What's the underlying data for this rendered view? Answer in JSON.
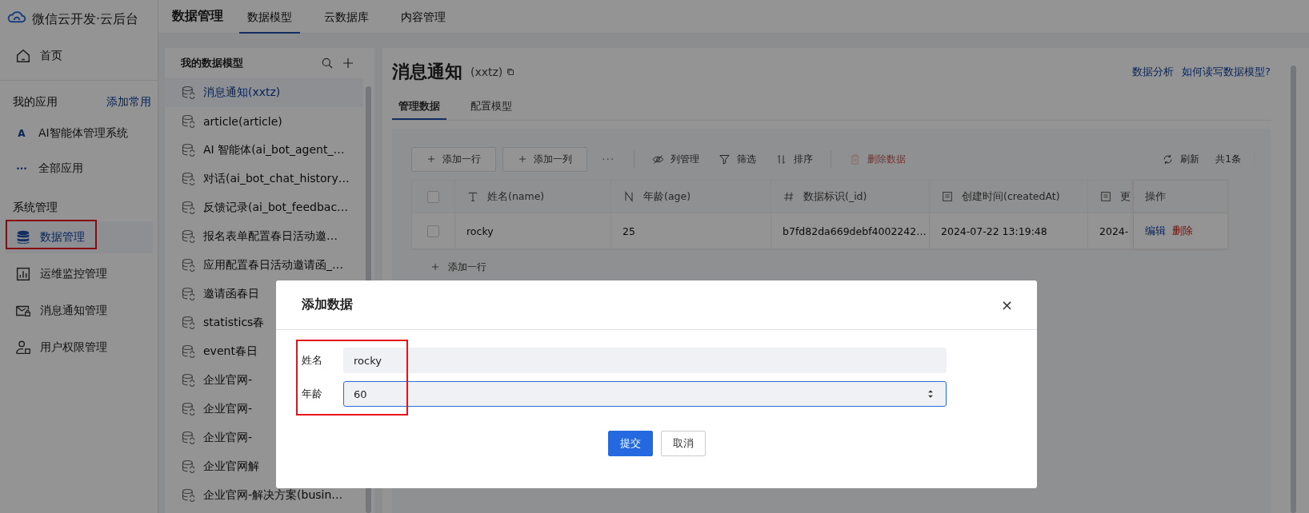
{
  "sidebar": {
    "logo": "微信云开发·云后台",
    "home": {
      "label": "首页",
      "selected": false
    },
    "apps_section": {
      "title": "我的应用",
      "action": "添加常用"
    },
    "apps": [
      {
        "avatar": "A",
        "label": "AI智能体管理系统"
      },
      {
        "avatar": "···",
        "label": "全部应用"
      }
    ],
    "system_section": {
      "title": "系统管理"
    },
    "items": [
      {
        "label": "数据管理",
        "selected": true,
        "marked": true
      },
      {
        "label": "运维监控管理",
        "selected": false,
        "marked": false
      },
      {
        "label": "消息通知管理",
        "selected": false,
        "marked": false
      },
      {
        "label": "用户权限管理",
        "selected": false,
        "marked": false
      }
    ]
  },
  "top_nav": {
    "title": "数据管理",
    "tabs": [
      {
        "label": "数据模型",
        "selected": true
      },
      {
        "label": "云数据库",
        "selected": false
      },
      {
        "label": "内容管理",
        "selected": false
      }
    ]
  },
  "model_list": {
    "title": "我的数据模型",
    "items": [
      {
        "label": "消息通知(xxtz)",
        "selected": true
      },
      {
        "label": "article(article)",
        "selected": false
      },
      {
        "label": "AI 智能体(ai_bot_agent_…",
        "selected": false
      },
      {
        "label": "对话(ai_bot_chat_history…",
        "selected": false
      },
      {
        "label": "反馈记录(ai_bot_feedbac…",
        "selected": false
      },
      {
        "label": "报名表单配置春日活动邀…",
        "selected": false
      },
      {
        "label": "应用配置春日活动邀请函_…",
        "selected": false
      },
      {
        "label": "邀请函春日",
        "selected": false
      },
      {
        "label": "statistics春",
        "selected": false
      },
      {
        "label": "event春日",
        "selected": false
      },
      {
        "label": "企业官网-",
        "selected": false
      },
      {
        "label": "企业官网-",
        "selected": false
      },
      {
        "label": "企业官网-",
        "selected": false
      },
      {
        "label": "企业官网解",
        "selected": false
      },
      {
        "label": "企业官网-解决方案(busin…",
        "selected": false
      }
    ]
  },
  "model": {
    "title": "消息通知",
    "code": "(xxtz)",
    "links": [
      "数据分析",
      "如何读写数据模型?"
    ],
    "tabs": [
      {
        "label": "管理数据",
        "selected": true
      },
      {
        "label": "配置模型",
        "selected": false
      }
    ],
    "add_buttons": [
      "添加一行",
      "添加一列"
    ],
    "more": "···",
    "actions": [
      {
        "label": "列管理",
        "disabled": false
      },
      {
        "label": "筛选",
        "disabled": false
      },
      {
        "label": "排序",
        "disabled": false
      },
      {
        "label": "删除数据",
        "disabled": true
      }
    ],
    "refresh": "刷新",
    "count": "共1条",
    "table": {
      "select_all": {
        "checked": false
      },
      "columns": [
        "姓名(name)",
        "年龄(age)",
        "数据标识(_id)",
        "创建时间(createdAt)",
        "更",
        "操作"
      ],
      "rows": [
        {
          "checked": false,
          "cells": [
            "rocky",
            "25",
            "b7fd82da669debf4002242…",
            "2024-07-22 13:19:48",
            "2024-"
          ],
          "actions": [
            "编辑",
            "删除"
          ]
        }
      ],
      "add_row": "添加一行"
    }
  },
  "dialog": {
    "title": "添加数据",
    "close": "×",
    "labels_marked": true,
    "fields": [
      {
        "label": "姓名",
        "value": "rocky",
        "kind": "text",
        "focused": false
      },
      {
        "label": "年龄",
        "value": "60",
        "kind": "number",
        "focused": true
      }
    ],
    "buttons": [
      {
        "label": "提交",
        "primary": true
      },
      {
        "label": "取消",
        "primary": false
      }
    ]
  }
}
